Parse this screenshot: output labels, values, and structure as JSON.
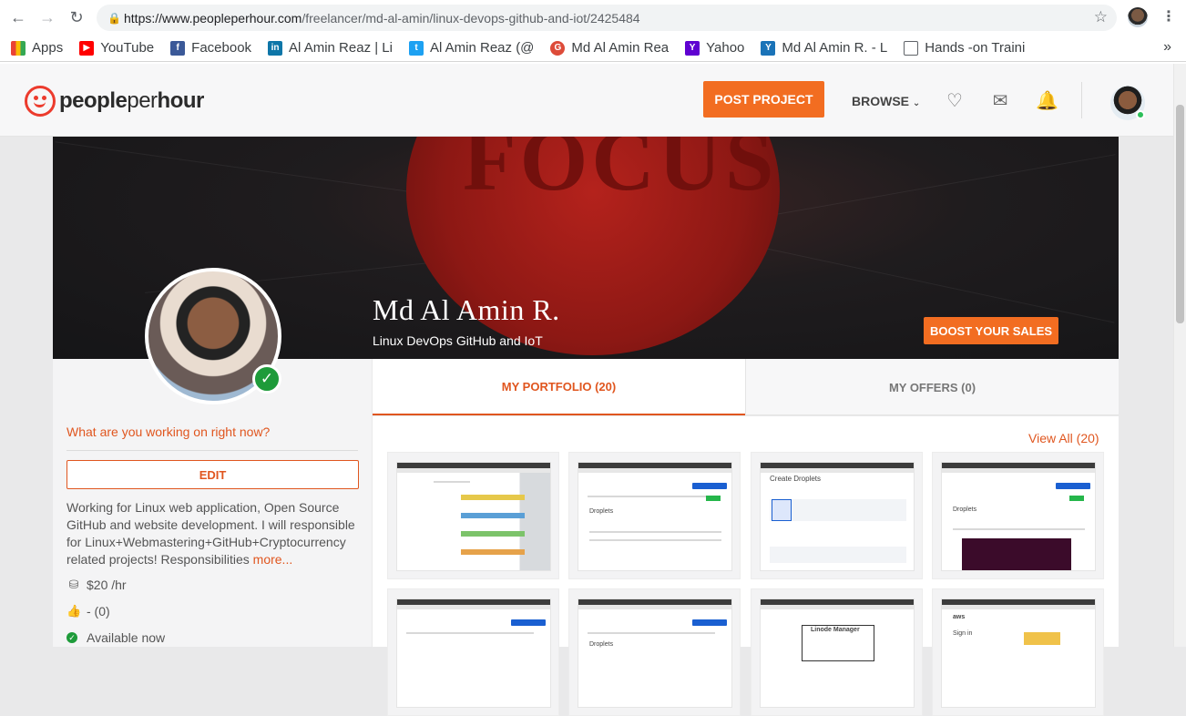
{
  "browser": {
    "url_host": "https://www.peopleperhour.com",
    "url_path": "/freelancer/md-al-amin/linux-devops-github-and-iot/2425484",
    "bookmarks": [
      {
        "label": "Apps",
        "icon": "apps-grid-icon",
        "color": "#e94335"
      },
      {
        "label": "YouTube",
        "icon": "youtube-icon",
        "color": "#ff0000"
      },
      {
        "label": "Facebook",
        "icon": "facebook-icon",
        "color": "#3b5998"
      },
      {
        "label": "Al Amin Reaz | Li",
        "icon": "linkedin-icon",
        "color": "#0e76a8"
      },
      {
        "label": "Al Amin Reaz (@",
        "icon": "twitter-icon",
        "color": "#1da1f2"
      },
      {
        "label": "Md Al Amin Rea",
        "icon": "google-plus-icon",
        "color": "#dd4b39"
      },
      {
        "label": "Yahoo",
        "icon": "yahoo-icon",
        "color": "#5f01d1"
      },
      {
        "label": "Md Al Amin R. - L",
        "icon": "yammer-icon",
        "color": "#1a73b8"
      },
      {
        "label": "Hands -on Traini",
        "icon": "page-icon",
        "color": "#5f6368"
      }
    ],
    "more": "»"
  },
  "header": {
    "logo_part1": "people",
    "logo_part2": "per",
    "logo_part3": "hour",
    "post_project": "POST PROJECT",
    "browse": "BROWSE"
  },
  "cover": {
    "focus_text": "FOCUS",
    "name": "Md Al Amin R.",
    "subtitle": "Linux DevOps GitHub and IoT",
    "boost": "BOOST YOUR SALES"
  },
  "profile": {
    "working_prompt": "What are you working on right now?",
    "edit": "EDIT",
    "bio": "Working for Linux web application, Open Source GitHub and website development. I will responsible for Linux+Webmastering+GitHub+Cryptocurrency related projects! Responsibilities",
    "more": "more...",
    "rate": "$20 /hr",
    "rating": "- (0)",
    "availability": "Available now"
  },
  "tabs": {
    "portfolio": "MY PORTFOLIO (20)",
    "offers": "MY OFFERS (0)"
  },
  "portfolio": {
    "view_all": "View All (20)",
    "thumb_headings": [
      "",
      "Droplets",
      "Create Droplets",
      "Droplets",
      "",
      "Droplets",
      "Linode Manager",
      "Sign in"
    ]
  },
  "colors": {
    "brand_orange": "#f26d21",
    "link_orange": "#e0561f",
    "logo_red": "#ec3b2d",
    "verified_green": "#1e9b3a"
  }
}
